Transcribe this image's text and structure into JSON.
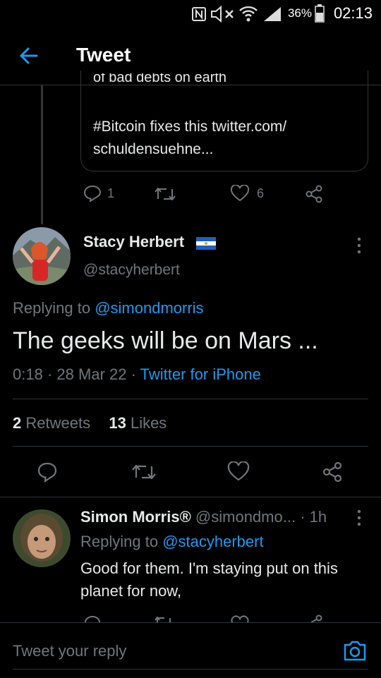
{
  "status_bar": {
    "battery_percent": "36%",
    "time": "02:13",
    "icons": [
      "nfc-icon",
      "mute-icon",
      "wifi-icon",
      "signal-icon",
      "battery-icon"
    ]
  },
  "header": {
    "title": "Tweet",
    "back_icon": "back-arrow-icon"
  },
  "quoted": {
    "cut_line": "of bad debts on earth",
    "text": "#Bitcoin fixes this twitter.com/ schuldensuehne..."
  },
  "quoted_actions": {
    "replies": "1",
    "likes": "6"
  },
  "main_tweet": {
    "name": "Stacy Herbert",
    "handle": "@stacyherbert",
    "replying_prefix": "Replying to",
    "replying_to": "@simondmorris",
    "text": "The geeks will be on Mars ...",
    "time": "0:18",
    "date": "28 Mar 22",
    "source": "Twitter for iPhone",
    "retweets_count": "2",
    "retweets_label": "Retweets",
    "likes_count": "13",
    "likes_label": "Likes"
  },
  "reply": {
    "name": "Simon Morris®",
    "handle": "@simondmo...",
    "age": "· 1h",
    "replying_prefix": "Replying to",
    "replying_to": "@stacyherbert",
    "text": "Good for them.  I'm staying put on this planet for now,"
  },
  "composer": {
    "placeholder": "Tweet your reply"
  },
  "colors": {
    "accent": "#1d9bf0",
    "background": "#000000",
    "muted": "#71767b"
  }
}
